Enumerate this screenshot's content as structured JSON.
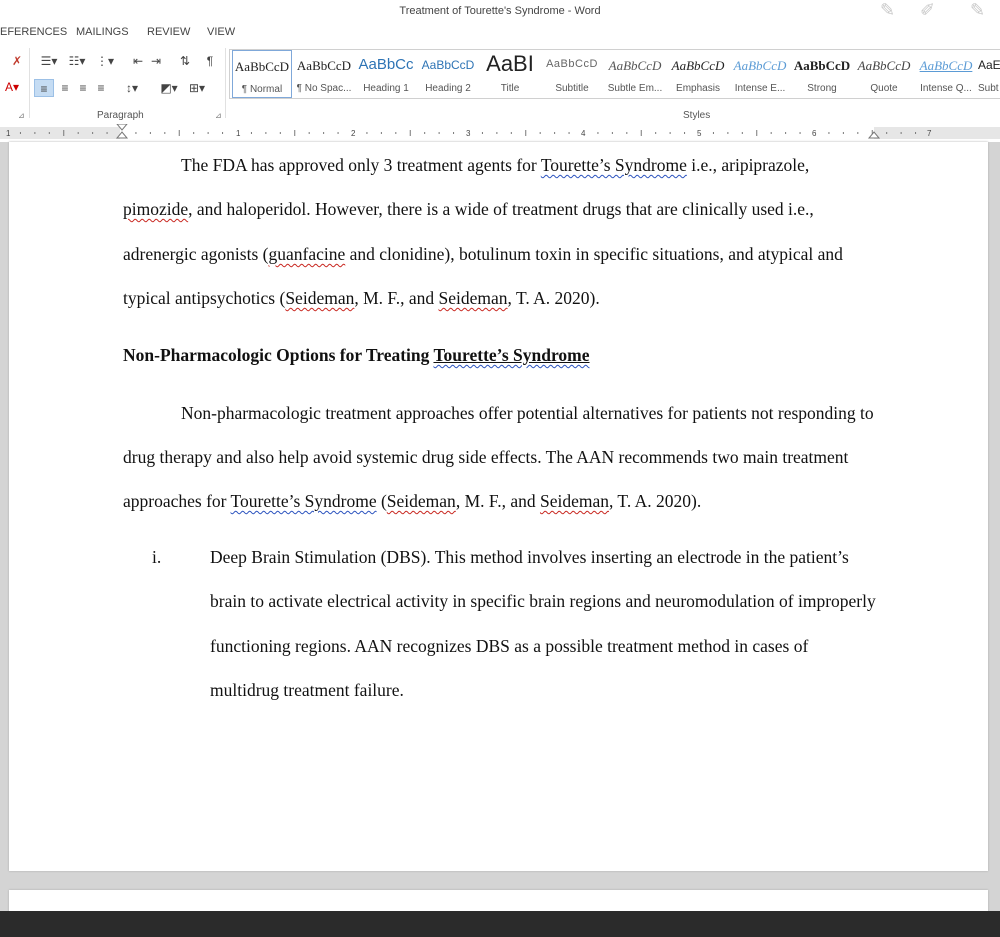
{
  "window": {
    "title": "Treatment of Tourette's Syndrome - Word"
  },
  "tabs": [
    "EFERENCES",
    "MAILINGS",
    "REVIEW",
    "VIEW"
  ],
  "ribbon": {
    "paragraph_label": "Paragraph",
    "styles_label": "Styles",
    "pilcrow": "¶",
    "styles": [
      {
        "preview": "AaBbCcD",
        "name": "¶ Normal"
      },
      {
        "preview": "AaBbCcD",
        "name": "¶ No Spac..."
      },
      {
        "preview": "AaBbCc",
        "name": "Heading 1"
      },
      {
        "preview": "AaBbCcD",
        "name": "Heading 2"
      },
      {
        "preview": "AaBI",
        "name": "Title"
      },
      {
        "preview": "AaBbCcD",
        "name": "Subtitle"
      },
      {
        "preview": "AaBbCcD",
        "name": "Subtle Em..."
      },
      {
        "preview": "AaBbCcD",
        "name": "Emphasis"
      },
      {
        "preview": "AaBbCcD",
        "name": "Intense E..."
      },
      {
        "preview": "AaBbCcD",
        "name": "Strong"
      },
      {
        "preview": "AaBbCcD",
        "name": "Quote"
      },
      {
        "preview": "AaBbCcD",
        "name": "Intense Q..."
      },
      {
        "preview": "AaBbCcD",
        "name": "Subt"
      }
    ]
  },
  "ruler": {
    "numbers": [
      "1",
      "1",
      "2",
      "3",
      "4",
      "5",
      "6",
      "7"
    ]
  },
  "document": {
    "p1": {
      "l1a": "The FDA has approved only 3 treatment agents for ",
      "l1b": "Tourette’s Syndrome",
      "l1c": " i.e., aripiprazole,",
      "l2a": "pimozide",
      "l2b": ", and haloperidol. However, there is a wide of treatment drugs that are clinically used i.e.,",
      "l3a": "adrenergic agonists (",
      "l3b": "guanfacine",
      "l3c": " and clonidine), botulinum toxin in specific situations, and atypical and",
      "l4a": "typical antipsychotics (",
      "l4b": "Seideman",
      "l4c": ", M. F., and ",
      "l4d": "Seideman",
      "l4e": ", T. A. 2020)."
    },
    "heading": {
      "a": "Non-Pharmacologic Options for Treating ",
      "b": "Tourette’s Syndrome"
    },
    "p2": {
      "l1": "Non-pharmacologic treatment approaches offer potential alternatives for patients not responding to",
      "l2": "drug therapy and also help avoid systemic drug side effects. The AAN recommends two main treatment",
      "l3a": "approaches for ",
      "l3b": "Tourette’s Syndrome",
      "l3c": " (",
      "l3d": "Seideman",
      "l3e": ", M. F., and ",
      "l3f": "Seideman",
      "l3g": ", T. A. 2020)."
    },
    "list": {
      "marker": "i.",
      "l1": "Deep Brain Stimulation (DBS). This method involves inserting an electrode in the patient’s",
      "l2": "brain to activate electrical activity in specific brain regions and neuromodulation of improperly",
      "l3": "functioning regions. AAN recognizes DBS as a possible treatment method in cases of",
      "l4": "multidrug treatment failure."
    }
  }
}
